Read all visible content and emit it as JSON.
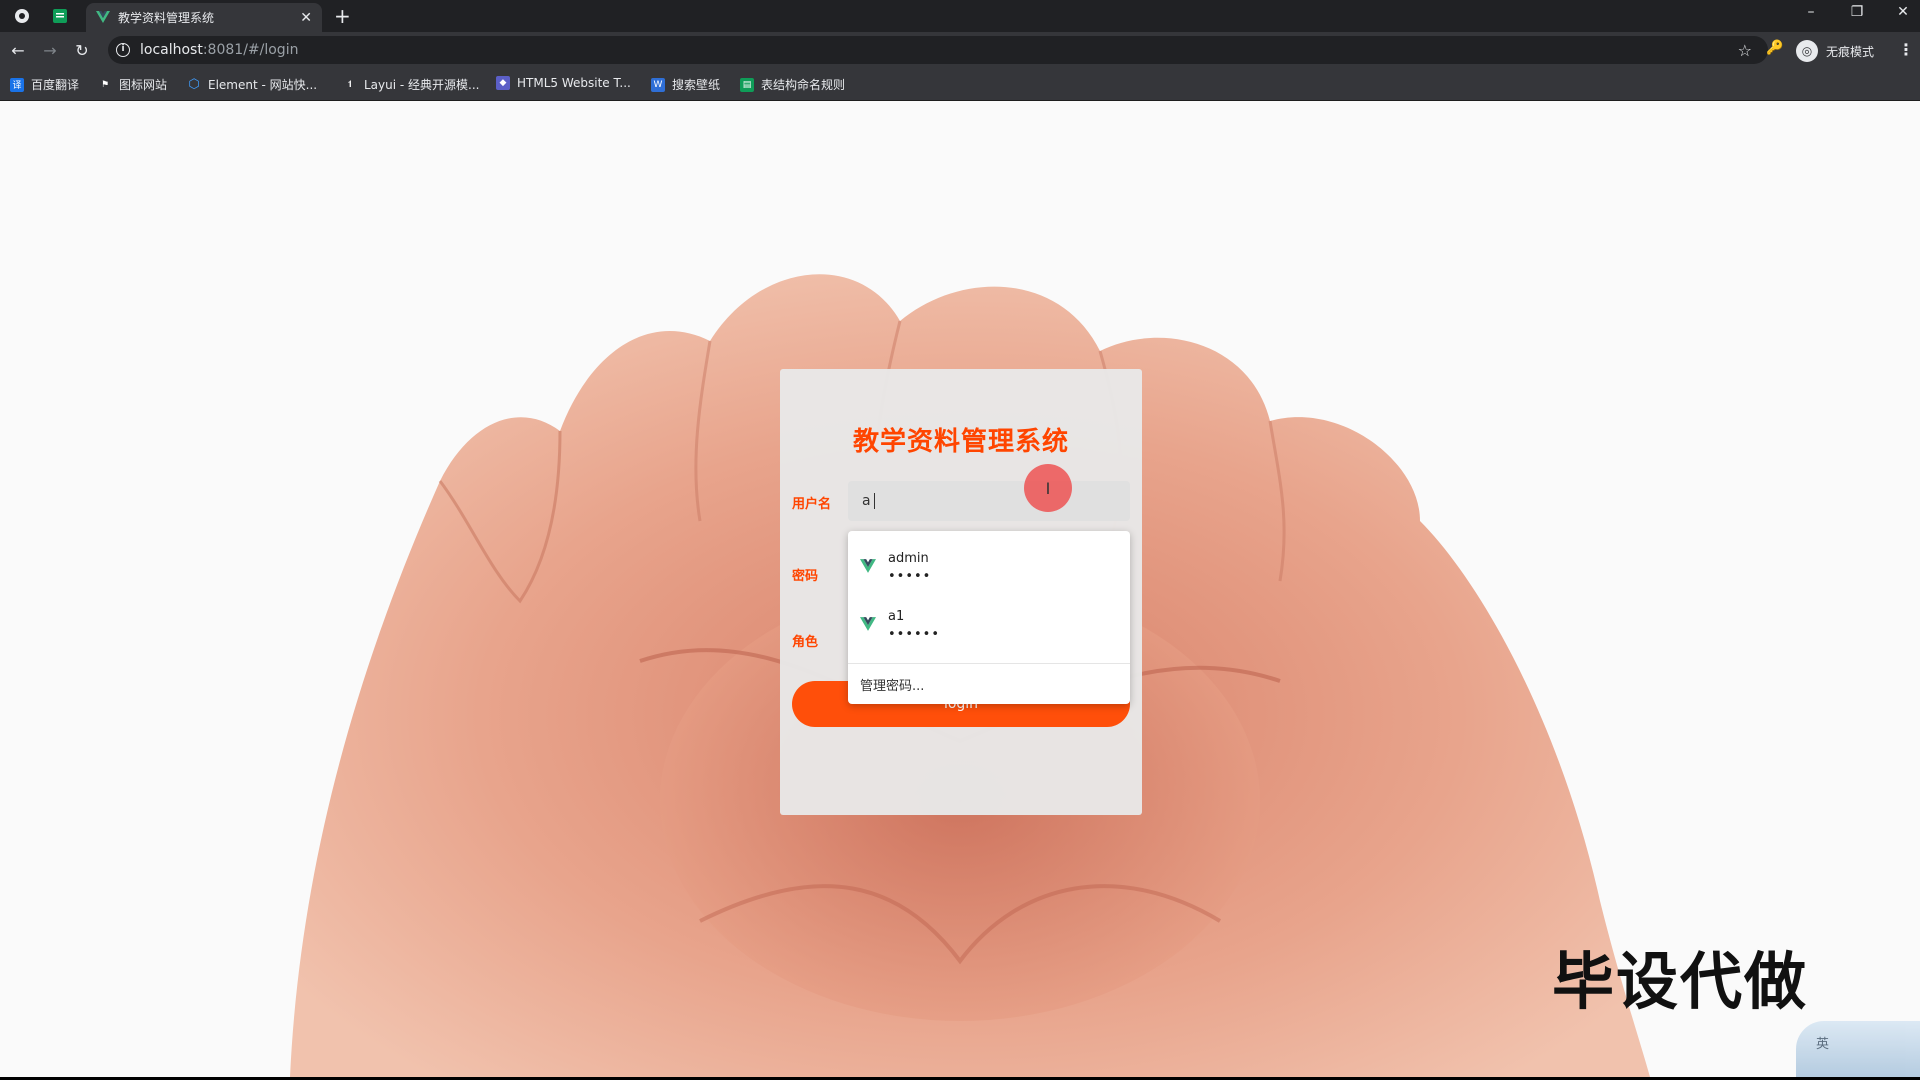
{
  "browser": {
    "tab_title": "教学资料管理系统",
    "url_host": "localhost",
    "url_rest": ":8081/#/login",
    "incognito_label": "无痕模式",
    "bookmarks": [
      {
        "label": "百度翻译",
        "icon": "translate-icon",
        "color": "#1a73e8"
      },
      {
        "label": "图标网站",
        "icon": "flag-icon",
        "color": "#35363a"
      },
      {
        "label": "Element - 网站快...",
        "icon": "element-hex-icon",
        "color": "#409eff"
      },
      {
        "label": "Layui - 经典开源模...",
        "icon": "layui-icon",
        "color": "#35363a"
      },
      {
        "label": "HTML5 Website T...",
        "icon": "html5-icon",
        "color": "#5b5fc7"
      },
      {
        "label": "搜索壁纸",
        "icon": "wallpaper-icon",
        "color": "#2f6fd6"
      },
      {
        "label": "表结构命名规则",
        "icon": "sheet-icon",
        "color": "#0f9d58"
      }
    ]
  },
  "login": {
    "title": "教学资料管理系统",
    "username_label": "用户名",
    "username_value": "a",
    "password_label": "密码",
    "role_label": "角色",
    "login_button": "login"
  },
  "autofill": {
    "entries": [
      {
        "username": "admin",
        "password_mask": "•••••"
      },
      {
        "username": "a1",
        "password_mask": "••••••"
      }
    ],
    "manage_label": "管理密码..."
  },
  "overlay": {
    "watermark": "毕设代做",
    "ime_label": "英"
  },
  "colors": {
    "accent": "#ff4500",
    "button": "#ff4f0a",
    "vue_green": "#41b883"
  }
}
